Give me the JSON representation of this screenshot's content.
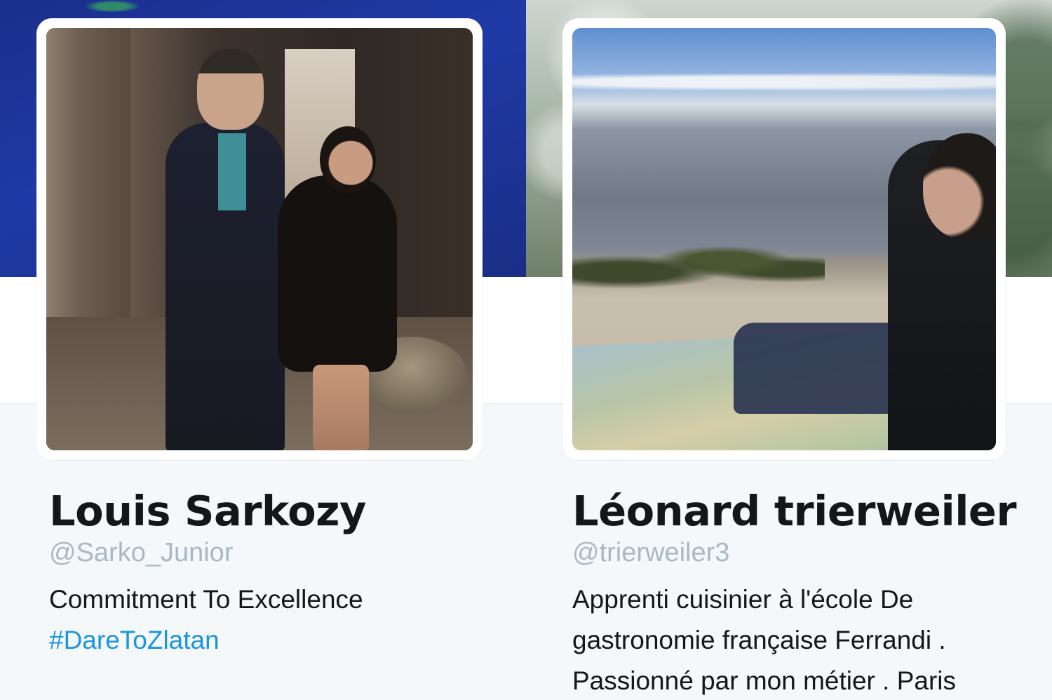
{
  "profiles": [
    {
      "name": "Louis Sarkozy",
      "handle": "@Sarko_Junior",
      "bio_line1": "Commitment To Excellence",
      "hashtag": "#DareToZlatan"
    },
    {
      "name": "Léonard trierweiler",
      "handle": "@trierweiler3",
      "bio_line1": "Apprenti cuisinier à l'école De",
      "bio_line2": "gastronomie française Ferrandi .",
      "bio_line3": "Passionné par mon métier . Paris"
    }
  ],
  "colors": {
    "handle": "#aab8c2",
    "hashtag": "#1b95e0",
    "text": "#14171a",
    "background": "#f5f8fa"
  }
}
